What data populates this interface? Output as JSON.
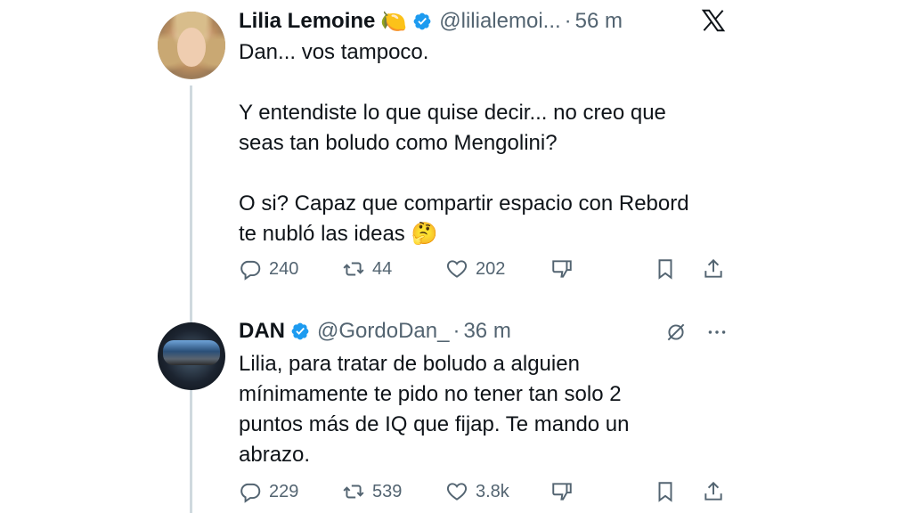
{
  "tweets": [
    {
      "name": "Lilia Lemoine",
      "name_emoji": "🍋",
      "handle": "@lilialemoi...",
      "separator": "·",
      "time": "56 m",
      "text": "Dan... vos tampoco.\n\nY entendiste lo que quise decir... no creo que\nseas tan boludo como Mengolini?\n\nO si? Capaz que compartir espacio con Rebord\nte nubló las ideas 🤔",
      "replies": "240",
      "reposts": "44",
      "likes": "202",
      "avatar_icon": "woman-portrait-avatar",
      "top_right_icon": "x-logo-icon"
    },
    {
      "name": "DAN",
      "handle": "@GordoDan_",
      "separator": "·",
      "time": "36 m",
      "text": "Lilia, para tratar de boludo a alguien\nmínimamente te pido no tener tan solo 2\npuntos más de IQ que fijap. Te mando un\nabrazo.",
      "replies": "229",
      "reposts": "539",
      "likes": "3.8k",
      "avatar_icon": "sunglasses-reflection-avatar",
      "top_right_icons": [
        "mute-icon",
        "more-icon"
      ]
    }
  ],
  "icons": {
    "verified": "verified-badge-icon",
    "reply": "reply-icon",
    "repost": "repost-icon",
    "like": "heart-icon",
    "dislike": "dislike-icon",
    "bookmark": "bookmark-icon",
    "share": "share-icon"
  },
  "colors": {
    "text": "#0f1419",
    "secondary": "#536471",
    "verified": "#1d9bf0",
    "thread_line": "#cfd9de"
  }
}
